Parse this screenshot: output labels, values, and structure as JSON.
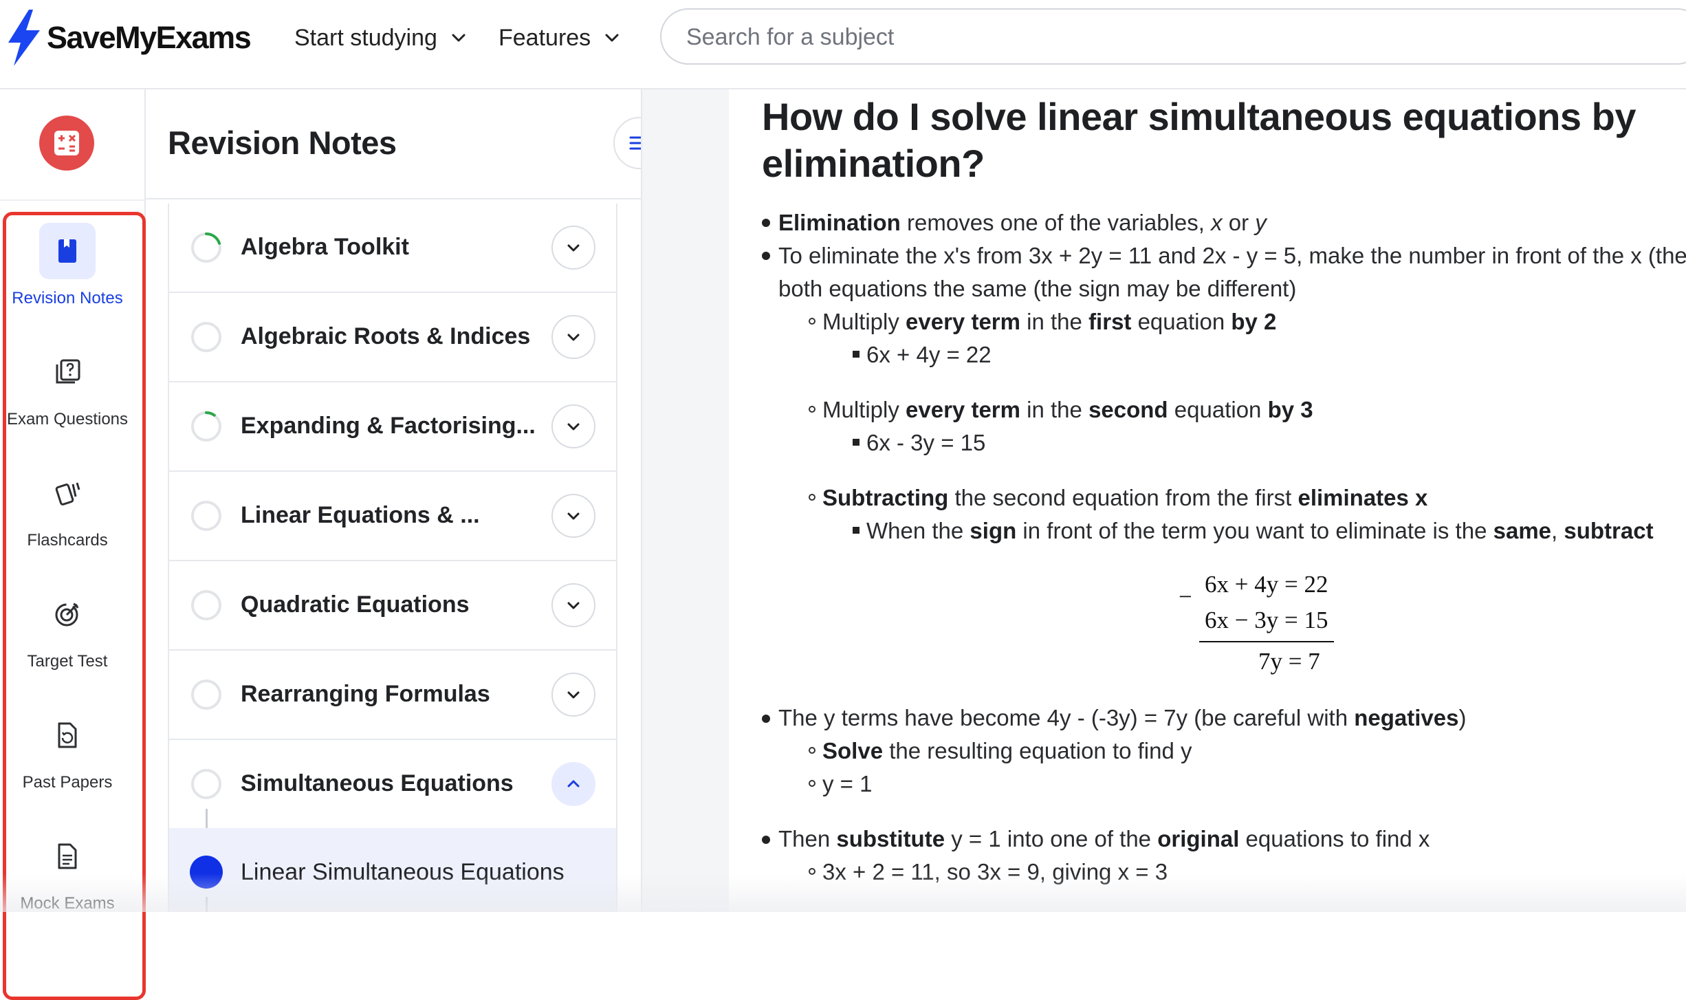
{
  "header": {
    "logo_text": "SaveMyExams",
    "nav": [
      {
        "label": "Start studying"
      },
      {
        "label": "Features"
      }
    ],
    "search_placeholder": "Search for a subject"
  },
  "rail": {
    "items": [
      {
        "label": "Revision Notes",
        "icon": "book-icon",
        "active": true
      },
      {
        "label": "Exam Questions",
        "icon": "question-card-icon"
      },
      {
        "label": "Flashcards",
        "icon": "flashcards-icon"
      },
      {
        "label": "Target Test",
        "icon": "target-icon"
      },
      {
        "label": "Past Papers",
        "icon": "past-paper-icon"
      },
      {
        "label": "Mock Exams",
        "icon": "document-icon"
      }
    ],
    "highlight_color": "#e8362f",
    "subject_badge_color": "#e34a4a"
  },
  "panel": {
    "title": "Revision Notes",
    "topics": [
      {
        "label": "Algebra Toolkit",
        "progress": 0.2,
        "expanded": false
      },
      {
        "label": "Algebraic Roots & Indices",
        "progress": 0,
        "expanded": false
      },
      {
        "label": "Expanding & Factorising...",
        "progress": 0.1,
        "expanded": false
      },
      {
        "label": "Linear Equations & ...",
        "progress": 0,
        "expanded": false
      },
      {
        "label": "Quadratic Equations",
        "progress": 0,
        "expanded": false
      },
      {
        "label": "Rearranging Formulas",
        "progress": 0,
        "expanded": false
      },
      {
        "label": "Simultaneous Equations",
        "progress": 0,
        "expanded": true
      }
    ],
    "subtopic": {
      "label": "Linear Simultaneous Equations"
    }
  },
  "article": {
    "heading": "How do I solve linear simultaneous equations by elimination?",
    "l1": {
      "b1": "Elimination",
      "t1": " removes one of the variables, ",
      "i1": "x",
      "t2": " or ",
      "i2": "y"
    },
    "l2": {
      "text": "To eliminate the x's from 3x + 2y = 11 and 2x - y = 5, make the number in front of the x (the"
    },
    "l3": {
      "text": "both equations the same (the sign may be different)"
    },
    "l4": {
      "t1": "Multiply ",
      "b1": "every term",
      "t2": " in the ",
      "b2": "first",
      "t3": " equation ",
      "b3": "by 2"
    },
    "l5": {
      "text": "6x + 4y = 22"
    },
    "l6": {
      "t1": "Multiply ",
      "b1": "every term",
      "t2": " in the ",
      "b2": "second",
      "t3": " equation ",
      "b3": "by 3"
    },
    "l7": {
      "text": "6x - 3y = 15"
    },
    "l8": {
      "b1": "Subtracting",
      "t1": " the second equation from the first ",
      "b2": "eliminates x"
    },
    "l9": {
      "t1": "When the ",
      "b1": "sign",
      "t2": " in front of the term you want to eliminate is the ",
      "b2": "same",
      "t3": ", ",
      "b3": "subtract"
    },
    "math": {
      "minus": "−",
      "eq1": "6x + 4y = 22",
      "eq2": "6x − 3y = 15",
      "result": "7y = 7"
    },
    "l10": {
      "t1": "The y terms have become 4y - (-3y) = 7y (be careful with ",
      "b1": "negatives",
      "t2": ")"
    },
    "l11": {
      "b1": "Solve",
      "t1": " the resulting equation to find y"
    },
    "l12": {
      "text": "y = 1"
    },
    "l13": {
      "t1": "Then ",
      "b1": "substitute",
      "t2": " y  = 1 into one of the ",
      "b2": "original",
      "t3": " equations to find x"
    },
    "l14": {
      "text": "3x + 2 = 11, so 3x = 9, giving x = 3"
    }
  }
}
